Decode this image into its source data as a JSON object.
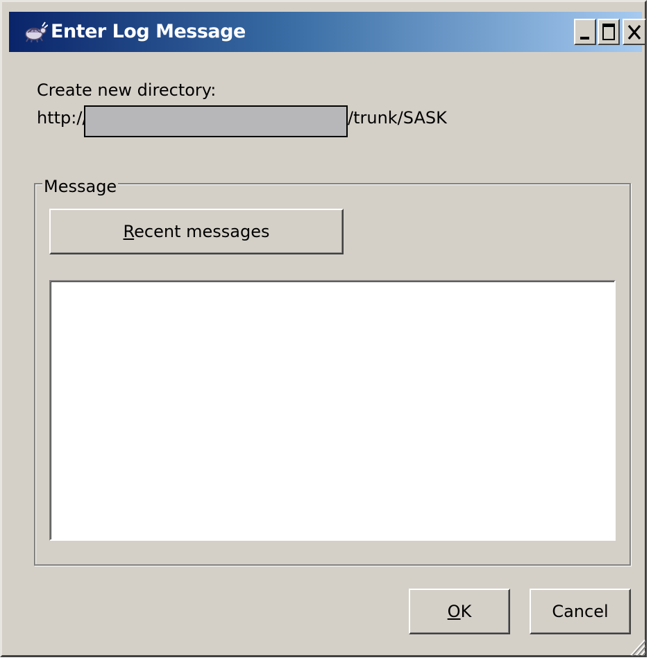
{
  "window": {
    "title": "Enter Log Message",
    "icon": "tortoise-svn-icon",
    "title_buttons": {
      "minimize": "minimize-icon",
      "maximize": "maximize-icon",
      "close": "close-icon"
    },
    "titlebar_gradient": [
      "#0a246a",
      "#a6caf0"
    ],
    "face_color": "#d4d0c8"
  },
  "info": {
    "create_label": "Create new directory:",
    "url_prefix": "http://s",
    "url_suffix": "/trunk/SASK"
  },
  "message_group": {
    "legend": "Message",
    "recent_button": {
      "mnemonic": "R",
      "rest": "ecent messages"
    },
    "message_text": ""
  },
  "footer": {
    "ok": {
      "mnemonic": "O",
      "rest": "K"
    },
    "cancel_label": "Cancel"
  }
}
